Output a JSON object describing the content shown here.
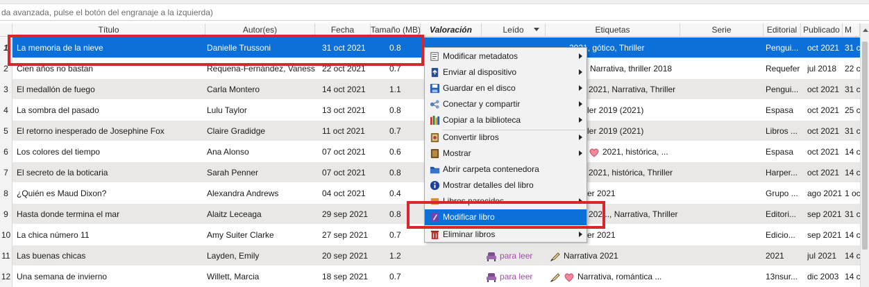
{
  "search": {
    "placeholder": "da avanzada, pulse el botón del engranaje a la izquierda)"
  },
  "columns": {
    "titulo": "Título",
    "autores": "Autor(es)",
    "fecha": "Fecha",
    "tamano": "Tamaño (MB)",
    "valoracion": "Valoración",
    "leido": "Leído",
    "etiquetas": "Etiquetas",
    "serie": "Serie",
    "editorial": "Editorial",
    "publicado": "Publicado",
    "extra": "M"
  },
  "rows": [
    {
      "num": "1",
      "title": "La memoria de la nieve",
      "author": "Danielle Trussoni",
      "date": "31 oct 2021",
      "size": "0.8",
      "tags": "2021, gótico, Thriller",
      "publisher": "Pengui...",
      "published": "oct 2021",
      "extra": "31 c"
    },
    {
      "num": "2",
      "title": "Cien años no bastan",
      "author": "Requena-Fernández, Vanessa",
      "date": "22 oct 2021",
      "size": "0.7",
      "tags": "Narrativa, thriller 2018",
      "publisher": "Requefer",
      "published": "jul 2018",
      "extra": "22 c"
    },
    {
      "num": "3",
      "title": "El medallón de fuego",
      "author": "Carla Montero",
      "date": "14 oct 2021",
      "size": "1.1",
      "tags": "2021, Narrativa, Thriller",
      "publisher": "Pengui...",
      "published": "oct 2021",
      "extra": "31 c"
    },
    {
      "num": "4",
      "title": "La sombra del pasado",
      "author": "Lulu Taylor",
      "date": "13 oct 2021",
      "size": "0.8",
      "tags": "ler 2019 (2021)",
      "publisher": "Espasa",
      "published": "oct 2021",
      "extra": "25 c"
    },
    {
      "num": "5",
      "title": "El retorno inesperado de Josephine Fox",
      "author": "Claire Gradidge",
      "date": "11 oct 2021",
      "size": "0.7",
      "tags": "ler 2019 (2021)",
      "publisher": "Libros ...",
      "published": "oct 2021",
      "extra": "31 c"
    },
    {
      "num": "6",
      "title": "Los colores del tiempo",
      "author": "Ana Alonso",
      "date": "07 oct 2021",
      "size": "0.6",
      "tags": "2021, histórica, ...",
      "publisher": "Espasa",
      "published": "oct 2021",
      "extra": "14 c"
    },
    {
      "num": "7",
      "title": "El secreto de la boticaria",
      "author": "Sarah Penner",
      "date": "07 oct 2021",
      "size": "0.8",
      "tags": "2021, histórica, Thriller",
      "publisher": "Harper...",
      "published": "oct 2021",
      "extra": "14 c"
    },
    {
      "num": "8",
      "title": "¿Quién es Maud Dixon?",
      "author": "Alexandra Andrews",
      "date": "04 oct 2021",
      "size": "0.4",
      "tags": "er 2021",
      "publisher": "Grupo ...",
      "published": "ago 2021",
      "extra": "1 oc"
    },
    {
      "num": "9",
      "title": "Hasta donde termina el mar",
      "author": "Alaitz Leceaga",
      "date": "29 sep 2021",
      "size": "0.8",
      "tags": "202..., Narrativa, Thriller",
      "publisher": "Editori...",
      "published": "sep 2021",
      "extra": "31 c"
    },
    {
      "num": "10",
      "title": "La chica número 11",
      "author": "Amy Suiter Clarke",
      "date": "27 sep 2021",
      "size": "0.7",
      "tags": "er 2021",
      "publisher": "Edicio...",
      "published": "sep 2021",
      "extra": "14 c"
    },
    {
      "num": "11",
      "title": "Las buenas chicas",
      "author": "Layden, Emily",
      "date": "20 sep 2021",
      "size": "1.2",
      "read": "para leer",
      "tags": "Narrativa 2021",
      "publisher": "2021",
      "published": "jul 2021",
      "extra": "14 c"
    },
    {
      "num": "12",
      "title": "Una semana de invierno",
      "author": "Willett, Marcia",
      "date": "18 sep 2021",
      "size": "0.7",
      "read": "para leer",
      "tags": "Narrativa, romántica ...",
      "publisher": "13nsur...",
      "published": "dic 2003",
      "extra": "14 c"
    }
  ],
  "menu": {
    "items": [
      {
        "label": "Modificar metadatos",
        "icon": "edit-metadata-icon"
      },
      {
        "label": "Enviar al dispositivo",
        "icon": "send-device-icon"
      },
      {
        "label": "Guardar en el disco",
        "icon": "save-disk-icon"
      },
      {
        "label": "Conectar y compartir",
        "icon": "share-icon"
      },
      {
        "label": "Copiar a la biblioteca",
        "icon": "library-icon"
      },
      {
        "label": "Convertir libros",
        "icon": "convert-icon"
      },
      {
        "label": "Mostrar",
        "icon": "view-icon"
      },
      {
        "label": "Abrir carpeta contenedora",
        "icon": "folder-icon"
      },
      {
        "label": "Mostrar detalles del libro",
        "icon": "info-icon"
      },
      {
        "label": "Libros parecidos",
        "icon": "similar-books-icon"
      },
      {
        "label": "Modificar libro",
        "icon": "edit-book-icon"
      },
      {
        "label": "Eliminar libros",
        "icon": "trash-icon"
      }
    ]
  },
  "colors": {
    "selection": "#0c70d8",
    "highlight_box": "#d9252c",
    "row_alt": "#e9e8e6"
  }
}
